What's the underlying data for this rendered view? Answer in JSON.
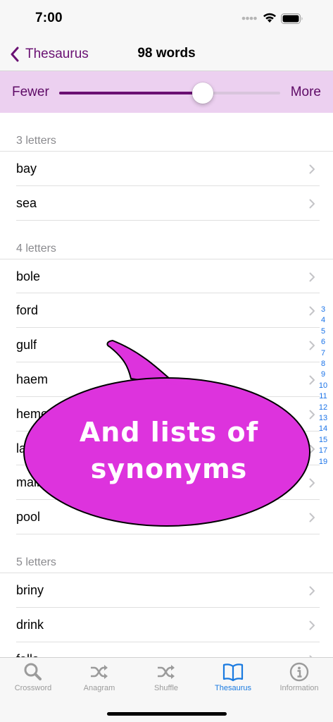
{
  "status": {
    "time": "7:00"
  },
  "nav": {
    "back_label": "Thesaurus",
    "title": "98 words"
  },
  "slider": {
    "min_label": "Fewer",
    "max_label": "More",
    "value_fraction": 0.65
  },
  "sections": [
    {
      "header": "3 letters",
      "words": [
        "bay",
        "sea"
      ]
    },
    {
      "header": "4 letters",
      "words": [
        "bole",
        "ford",
        "gulf",
        "haem",
        "heme",
        "lake",
        "main",
        "pool"
      ]
    },
    {
      "header": "5 letters",
      "words": [
        "briny",
        "drink",
        "falls"
      ]
    }
  ],
  "index": [
    "3",
    "4",
    "5",
    "6",
    "7",
    "8",
    "9",
    "10",
    "11",
    "12",
    "13",
    "14",
    "15",
    "17",
    "19"
  ],
  "callout": {
    "line1": "And lists of",
    "line2": "synonyms"
  },
  "tabs": [
    {
      "label": "Crossword",
      "icon": "magnifier-icon",
      "active": false
    },
    {
      "label": "Anagram",
      "icon": "shuffle-icon",
      "active": false
    },
    {
      "label": "Shuffle",
      "icon": "shuffle-icon",
      "active": false
    },
    {
      "label": "Thesaurus",
      "icon": "book-icon",
      "active": true
    },
    {
      "label": "Information",
      "icon": "info-icon",
      "active": false
    }
  ],
  "colors": {
    "accent": "#6a1173",
    "slider_bg": "#ecd0f0",
    "bubble_fill": "#dd33dd",
    "tab_active": "#1a7ae0",
    "index_link": "#1a73e8"
  }
}
